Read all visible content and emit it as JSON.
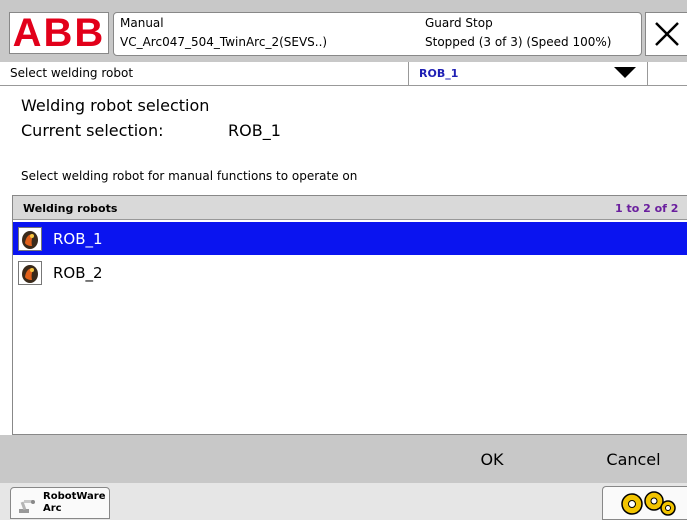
{
  "header": {
    "logo_text": "ABB",
    "mode": "Manual",
    "task": "VC_Arc047_504_TwinArc_2(SEVS..)",
    "guard_status": "Guard Stop",
    "run_status": "Stopped (3 of 3) (Speed 100%)",
    "close_icon": "close-icon"
  },
  "title_row": {
    "title": "Select welding robot",
    "dropdown_value": "ROB_1"
  },
  "selection": {
    "heading": "Welding robot selection",
    "current_label": "Current selection:",
    "current_value": "ROB_1",
    "instructions": "Select welding robot for manual functions to operate on"
  },
  "list": {
    "title": "Welding robots",
    "range": "1 to 2 of 2",
    "items": [
      {
        "label": "ROB_1",
        "selected": true,
        "icon": "robot-icon"
      },
      {
        "label": "ROB_2",
        "selected": false,
        "icon": "robot-icon"
      }
    ]
  },
  "actions": {
    "ok_label": "OK",
    "cancel_label": "Cancel"
  },
  "taskbar": {
    "task_label": "RobotWare Arc",
    "task_icon": "robot-arm-icon",
    "quickset_icon": "gears-icon"
  },
  "colors": {
    "selection": "#0a14f0",
    "logo_red": "#e2001a",
    "dropdown_text": "#1f1fb4",
    "range_text": "#6a1f9e"
  }
}
